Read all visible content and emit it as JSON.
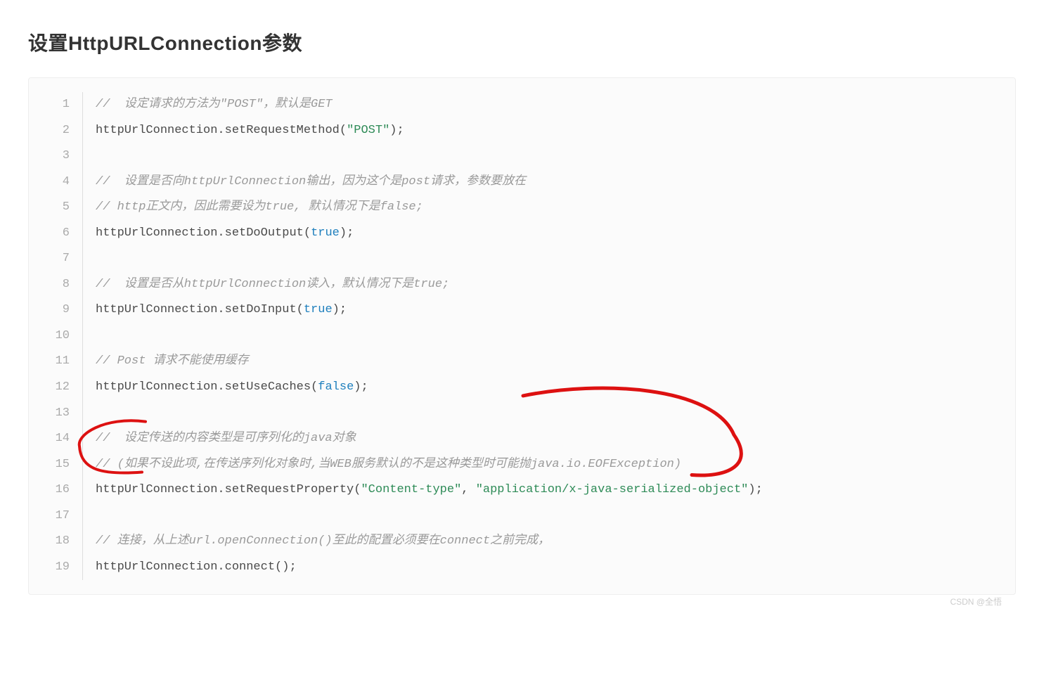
{
  "title": "设置HttpURLConnection参数",
  "watermark": "CSDN @全悟",
  "code": {
    "lines": [
      {
        "n": "1",
        "tokens": [
          {
            "t": "//  设定请求的方法为\"POST\"，默认是GET",
            "c": "cmt"
          }
        ]
      },
      {
        "n": "2",
        "tokens": [
          {
            "t": "httpUrlConnection.setRequestMethod(",
            "c": ""
          },
          {
            "t": "\"POST\"",
            "c": "str"
          },
          {
            "t": ");",
            "c": ""
          }
        ]
      },
      {
        "n": "3",
        "tokens": [
          {
            "t": "",
            "c": ""
          }
        ]
      },
      {
        "n": "4",
        "tokens": [
          {
            "t": "//  设置是否向httpUrlConnection输出，因为这个是post请求，参数要放在",
            "c": "cmt"
          }
        ]
      },
      {
        "n": "5",
        "tokens": [
          {
            "t": "// http正文内，因此需要设为true, 默认情况下是false;",
            "c": "cmt"
          }
        ]
      },
      {
        "n": "6",
        "tokens": [
          {
            "t": "httpUrlConnection.setDoOutput(",
            "c": ""
          },
          {
            "t": "true",
            "c": "kw"
          },
          {
            "t": ");",
            "c": ""
          }
        ]
      },
      {
        "n": "7",
        "tokens": [
          {
            "t": "",
            "c": ""
          }
        ]
      },
      {
        "n": "8",
        "tokens": [
          {
            "t": "//  设置是否从httpUrlConnection读入，默认情况下是true;",
            "c": "cmt"
          }
        ]
      },
      {
        "n": "9",
        "tokens": [
          {
            "t": "httpUrlConnection.setDoInput(",
            "c": ""
          },
          {
            "t": "true",
            "c": "kw"
          },
          {
            "t": ");",
            "c": ""
          }
        ]
      },
      {
        "n": "10",
        "tokens": [
          {
            "t": "",
            "c": ""
          }
        ]
      },
      {
        "n": "11",
        "tokens": [
          {
            "t": "// Post 请求不能使用缓存",
            "c": "cmt"
          }
        ]
      },
      {
        "n": "12",
        "tokens": [
          {
            "t": "httpUrlConnection.setUseCaches(",
            "c": ""
          },
          {
            "t": "false",
            "c": "kw"
          },
          {
            "t": ");",
            "c": ""
          }
        ]
      },
      {
        "n": "13",
        "tokens": [
          {
            "t": "",
            "c": ""
          }
        ]
      },
      {
        "n": "14",
        "tokens": [
          {
            "t": "//  设定传送的内容类型是可序列化的java对象",
            "c": "cmt"
          }
        ]
      },
      {
        "n": "15",
        "tokens": [
          {
            "t": "// (如果不设此项,在传送序列化对象时,当WEB服务默认的不是这种类型时可能抛java.io.EOFException)",
            "c": "cmt"
          }
        ]
      },
      {
        "n": "16",
        "tokens": [
          {
            "t": "httpUrlConnection.setRequestProperty(",
            "c": ""
          },
          {
            "t": "\"Content-type\"",
            "c": "str"
          },
          {
            "t": ", ",
            "c": ""
          },
          {
            "t": "\"application/x-java-serialized-object\"",
            "c": "str"
          },
          {
            "t": ");",
            "c": ""
          }
        ]
      },
      {
        "n": "17",
        "tokens": [
          {
            "t": "",
            "c": ""
          }
        ]
      },
      {
        "n": "18",
        "tokens": [
          {
            "t": "// 连接，从上述url.openConnection()至此的配置必须要在connect之前完成，",
            "c": "cmt"
          }
        ]
      },
      {
        "n": "19",
        "tokens": [
          {
            "t": "httpUrlConnection.connect();",
            "c": ""
          }
        ]
      }
    ]
  }
}
